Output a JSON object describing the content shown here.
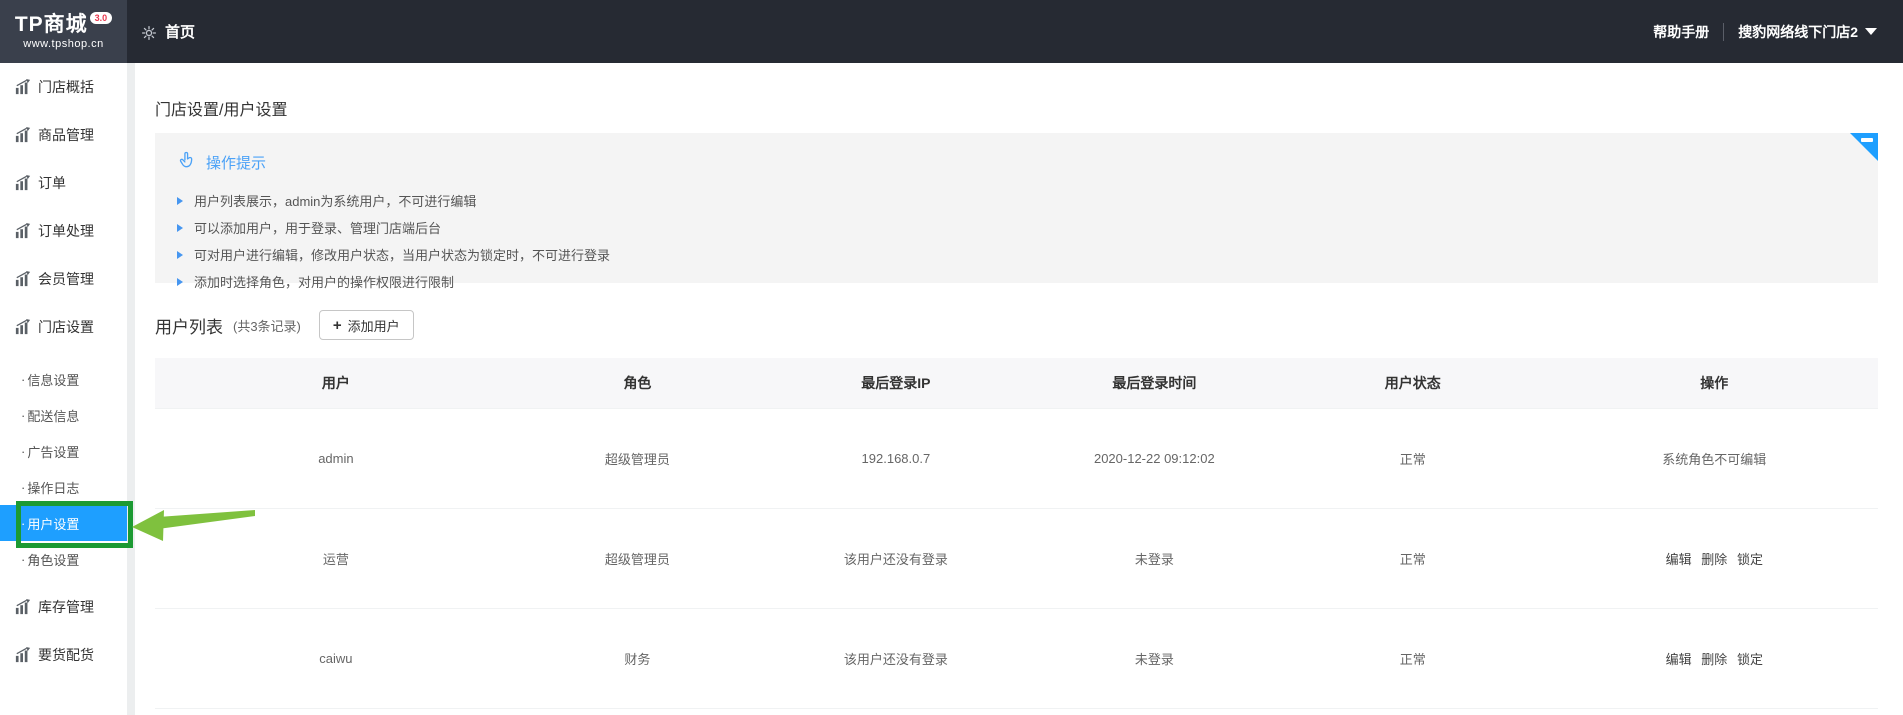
{
  "navbar": {
    "logo_title": "TP商城",
    "logo_badge": "3.0",
    "logo_subtitle": "www.tpshop.cn",
    "home_label": "首页",
    "help_label": "帮助手册",
    "store_label": "搜豹网络线下门店2"
  },
  "sidebar": {
    "items": [
      {
        "label": "门店概括",
        "type": "top"
      },
      {
        "label": "商品管理",
        "type": "top"
      },
      {
        "label": "订单",
        "type": "top"
      },
      {
        "label": "订单处理",
        "type": "top"
      },
      {
        "label": "会员管理",
        "type": "top"
      },
      {
        "label": "门店设置",
        "type": "top"
      },
      {
        "label": "信息设置",
        "type": "sub"
      },
      {
        "label": "配送信息",
        "type": "sub"
      },
      {
        "label": "广告设置",
        "type": "sub"
      },
      {
        "label": "操作日志",
        "type": "sub"
      },
      {
        "label": "用户设置",
        "type": "sub",
        "active": true
      },
      {
        "label": "角色设置",
        "type": "sub"
      },
      {
        "label": "库存管理",
        "type": "top"
      },
      {
        "label": "要货配货",
        "type": "top"
      }
    ]
  },
  "main": {
    "page_title": "门店设置/用户设置",
    "tips": {
      "title": "操作提示",
      "items": [
        "用户列表展示，admin为系统用户，不可进行编辑",
        "可以添加用户，用于登录、管理门店端后台",
        "可对用户进行编辑，修改用户状态，当用户状态为锁定时，不可进行登录",
        "添加时选择角色，对用户的操作权限进行限制"
      ]
    },
    "list": {
      "title": "用户列表",
      "count": "(共3条记录)",
      "add_button": "添加用户",
      "plus": "+"
    },
    "table": {
      "headers": [
        "用户",
        "角色",
        "最后登录IP",
        "最后登录时间",
        "用户状态",
        "操作"
      ],
      "rows": [
        {
          "user": "admin",
          "role": "超级管理员",
          "ip": "192.168.0.7",
          "time": "2020-12-22 09:12:02",
          "status": "正常",
          "actions": [
            "系统角色不可编辑"
          ]
        },
        {
          "user": "运营",
          "role": "超级管理员",
          "ip": "该用户还没有登录",
          "time": "未登录",
          "status": "正常",
          "actions": [
            "编辑",
            "删除",
            "锁定"
          ]
        },
        {
          "user": "caiwu",
          "role": "财务",
          "ip": "该用户还没有登录",
          "time": "未登录",
          "status": "正常",
          "actions": [
            "编辑",
            "删除",
            "锁定"
          ]
        }
      ]
    }
  },
  "colors": {
    "navbar_bg": "#262a33",
    "logo_block_bg": "#3a404c",
    "accent_blue": "#1e9fff",
    "tips_title_blue": "#4ba2f7",
    "annotation_green": "#1c9a33",
    "annotation_arrow_green": "#7fc13e",
    "badge_red": "#e8384f",
    "tips_bg": "#f4f4f4",
    "table_header_bg": "#f7f7f9"
  }
}
